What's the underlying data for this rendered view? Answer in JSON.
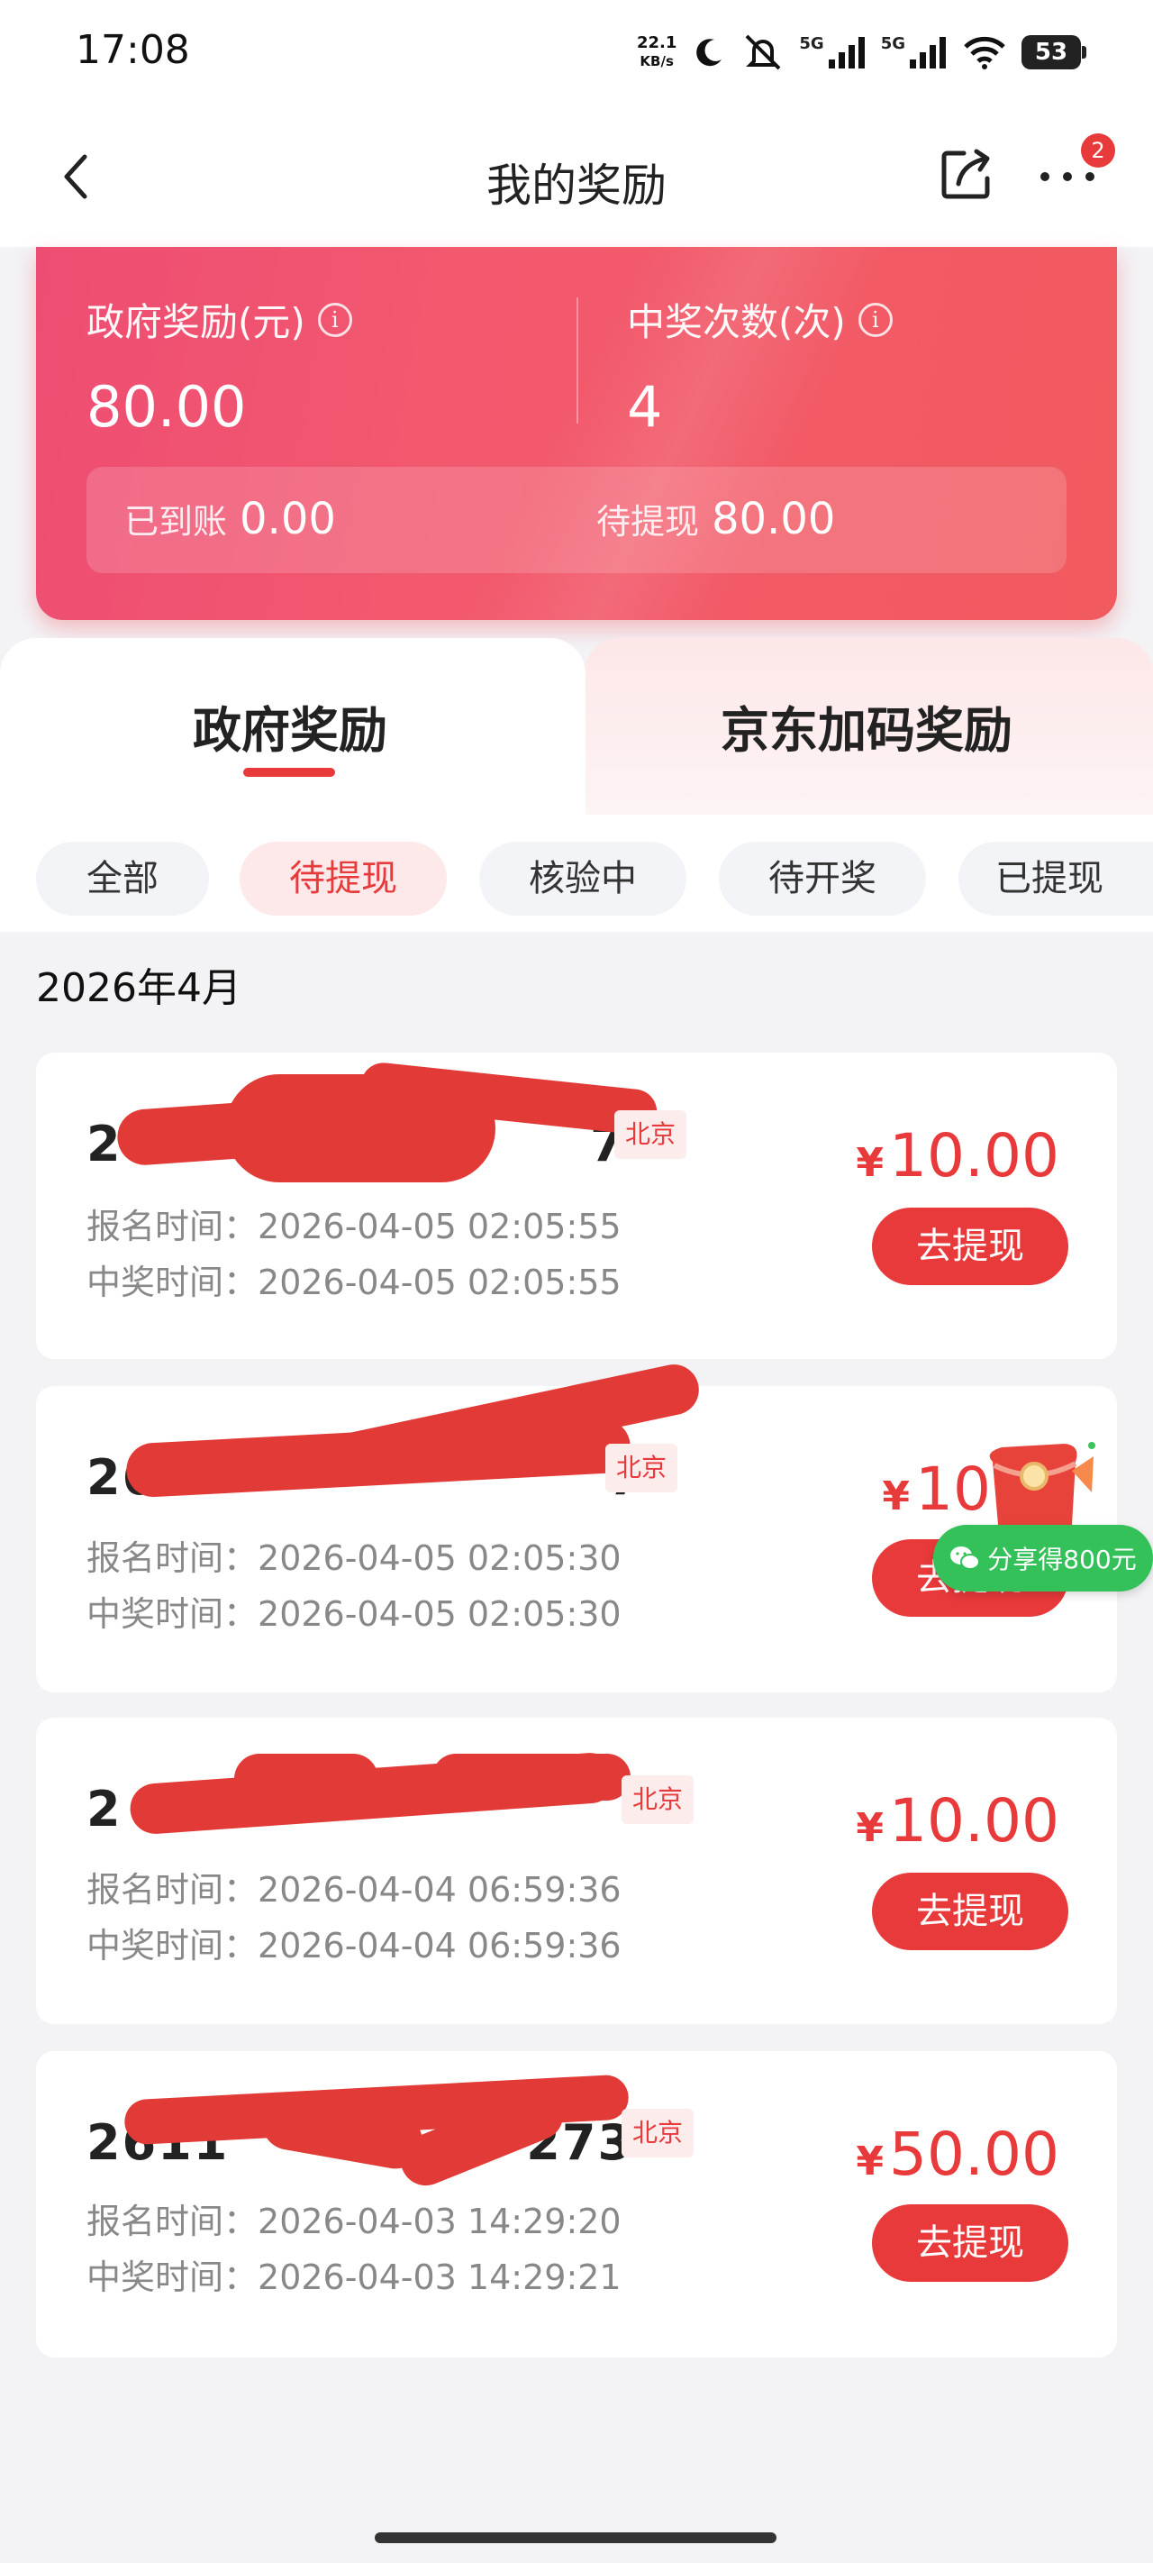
{
  "status_bar": {
    "time": "17:08",
    "net_speed_value": "22.1",
    "net_speed_unit": "KB/s",
    "signal1": "5G",
    "signal2": "5G",
    "battery": "53"
  },
  "nav": {
    "title": "我的奖励",
    "badge": "2"
  },
  "summary": {
    "gov_reward_label": "政府奖励(元)",
    "gov_reward_value": "80.00",
    "win_count_label": "中奖次数(次)",
    "win_count_value": "4",
    "received_label": "已到账",
    "received_value": "0.00",
    "pending_label": "待提现",
    "pending_value": "80.00"
  },
  "tabs": [
    "政府奖励",
    "京东加码奖励"
  ],
  "filters": [
    "全部",
    "待提现",
    "核验中",
    "待开奖",
    "已提现"
  ],
  "month": "2026年4月",
  "labels": {
    "signup_time": "报名时间：",
    "win_time": "中奖时间：",
    "currency": "¥",
    "withdraw": "去提现"
  },
  "records": [
    {
      "id_visible": "26",
      "id_tail": "7",
      "city": "北京",
      "signup": "2026-04-05 02:05:55",
      "win": "2026-04-05 02:05:55",
      "amount": "10.00"
    },
    {
      "id_visible": "26",
      "id_tail": "7",
      "city": "北京",
      "signup": "2026-04-05 02:05:30",
      "win": "2026-04-05 02:05:30",
      "amount": "10"
    },
    {
      "id_visible": "2",
      "id_tail": "",
      "city": "北京",
      "signup": "2026-04-04 06:59:36",
      "win": "2026-04-04 06:59:36",
      "amount": "10.00"
    },
    {
      "id_visible": "2611",
      "id_tail": "273",
      "city": "北京",
      "signup": "2026-04-03 14:29:20",
      "win": "2026-04-03 14:29:21",
      "amount": "50.00"
    }
  ],
  "share_float": {
    "label": "分享得800元"
  }
}
